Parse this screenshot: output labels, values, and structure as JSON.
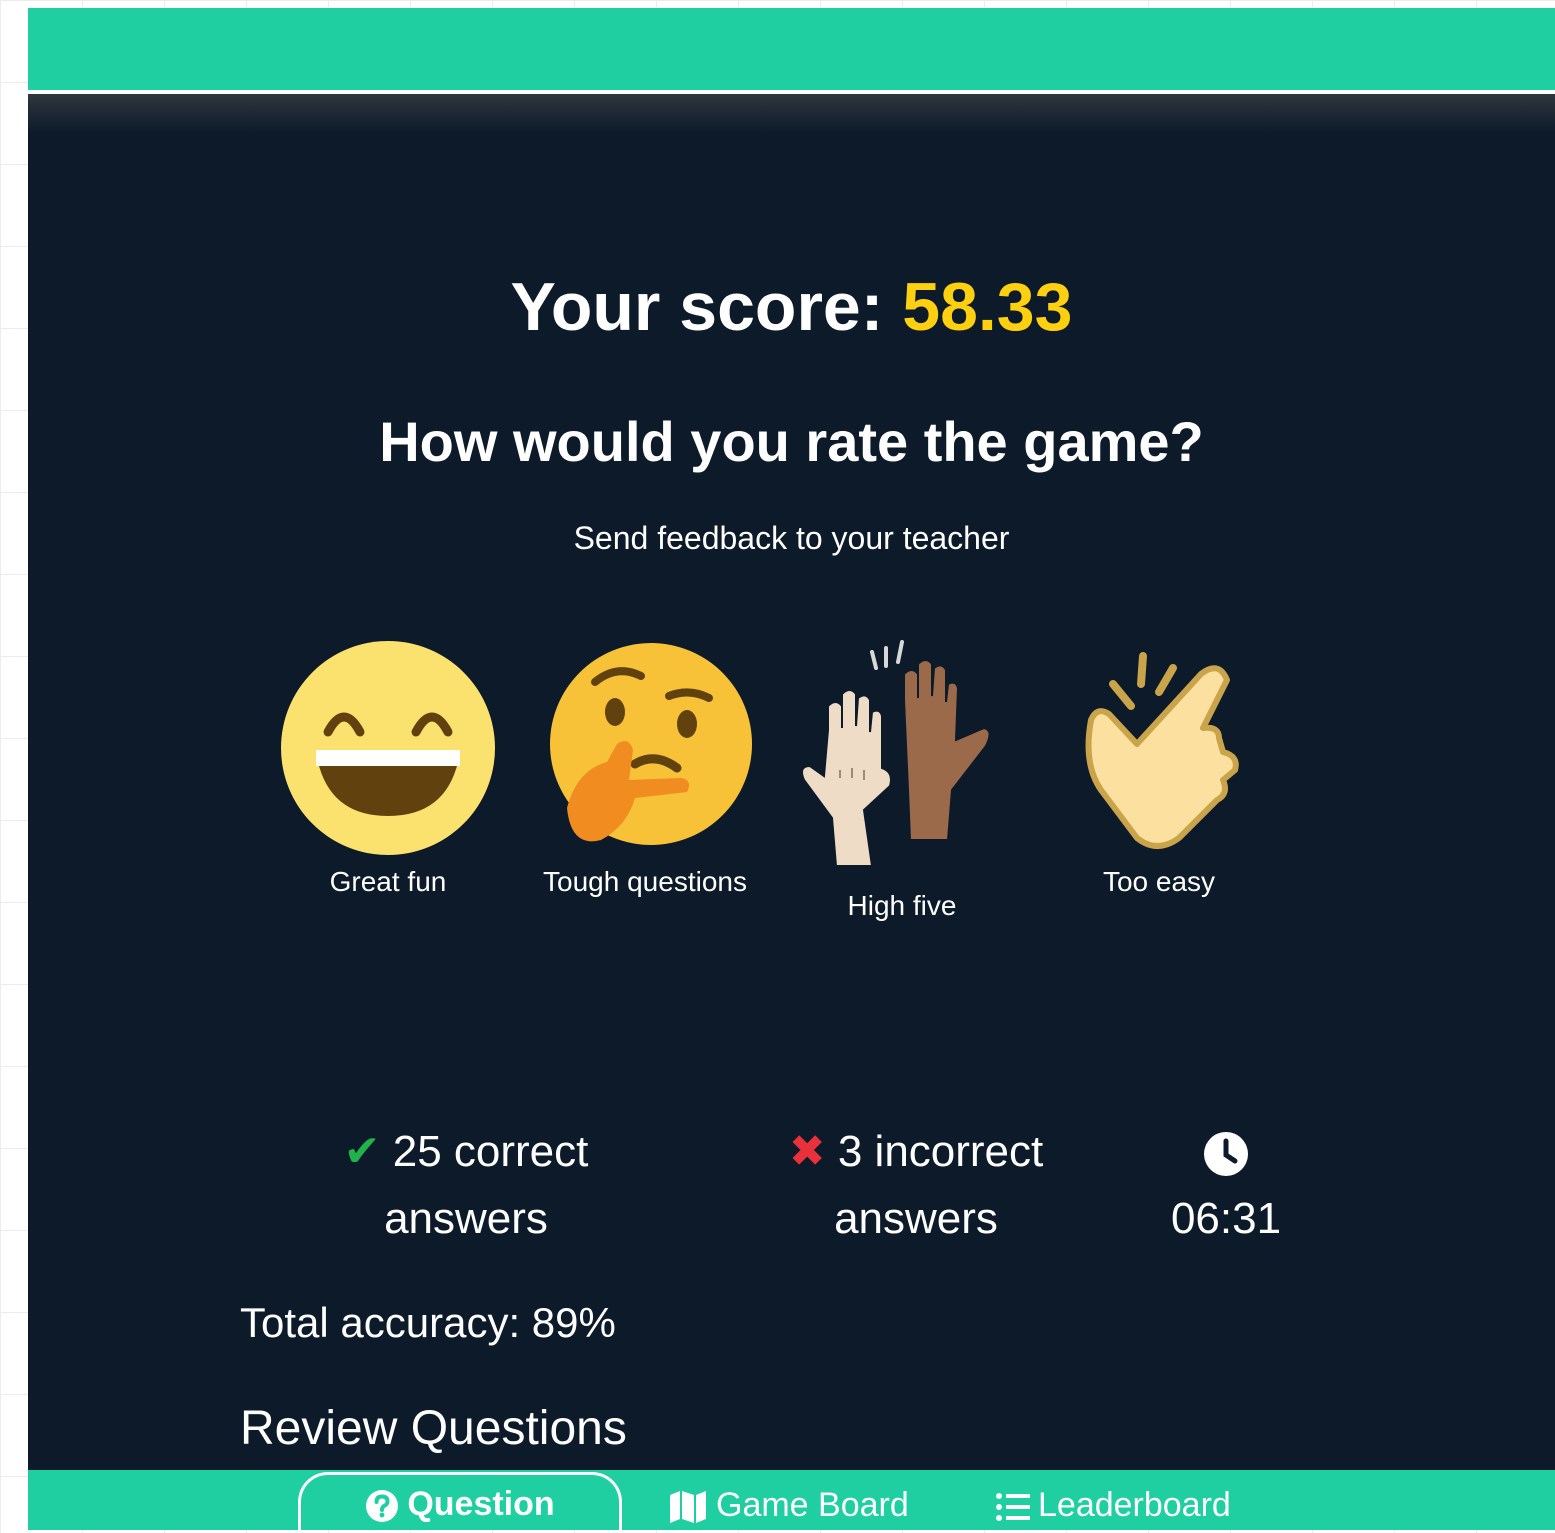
{
  "score": {
    "label": "Your score:",
    "value": "58.33"
  },
  "rating": {
    "question": "How would you rate the game?",
    "subtitle": "Send feedback to your teacher",
    "options": [
      {
        "label": "Great fun",
        "icon": "grinning-face-icon"
      },
      {
        "label": "Tough questions",
        "icon": "thinking-face-icon"
      },
      {
        "label": "High five",
        "icon": "high-five-hands-icon"
      },
      {
        "label": "Too easy",
        "icon": "finger-snap-icon"
      }
    ]
  },
  "stats": {
    "correct": {
      "count": "25 correct",
      "unit": "answers",
      "icon": "check-icon",
      "color": "#22b24c"
    },
    "incorrect": {
      "count": "3 incorrect",
      "unit": "answers",
      "icon": "cross-icon",
      "color": "#e8313b"
    },
    "time": {
      "value": "06:31",
      "icon": "clock-icon"
    },
    "accuracy": "Total accuracy: 89%"
  },
  "review": {
    "title": "Review Questions"
  },
  "nav": {
    "tabs": [
      {
        "label": "Question",
        "icon": "question-circle-icon",
        "active": true
      },
      {
        "label": "Game Board",
        "icon": "map-icon",
        "active": false
      },
      {
        "label": "Leaderboard",
        "icon": "list-icon",
        "active": false
      }
    ]
  },
  "colors": {
    "accent": "#20cfa1",
    "background": "#0c1a2a",
    "score_highlight": "#ffd00f"
  }
}
